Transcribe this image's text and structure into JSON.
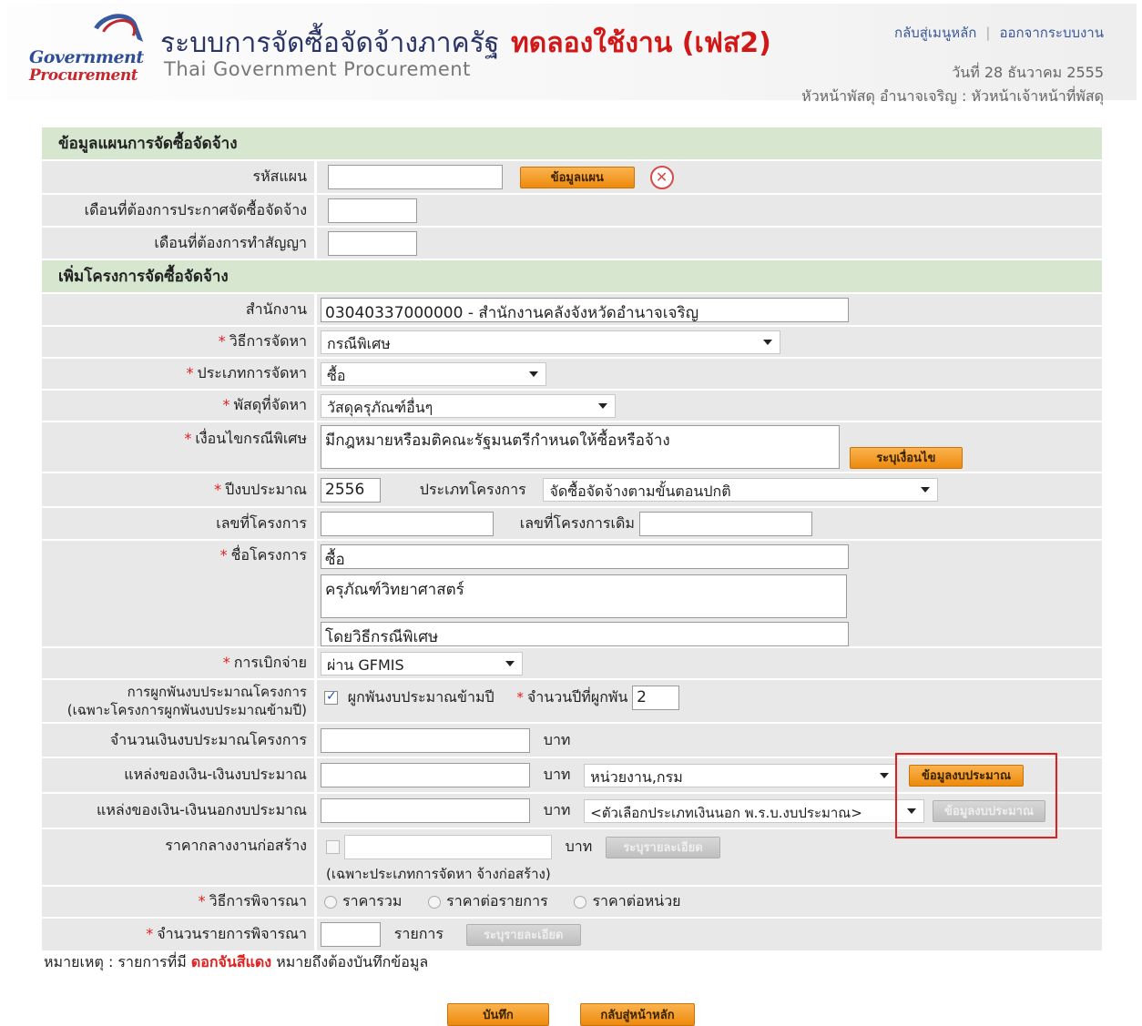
{
  "header": {
    "logo_line1": "Government",
    "logo_line2": "Procurement",
    "title_th": "ระบบการจัดซื้อจัดจ้างภาครัฐ",
    "title_trial": "ทดลองใช้งาน (เฟส2)",
    "title_en": "Thai Government Procurement",
    "link_home": "กลับสู่เมนูหลัก",
    "link_sep": "|",
    "link_logout": "ออกจากระบบงาน",
    "date": "วันที่ 28 ธันวาคม 2555",
    "user": "หัวหน้าพัสดุ อำนาจเจริญ : หัวหน้าเจ้าหน้าที่พัสดุ"
  },
  "plan_section": {
    "title": "ข้อมูลแผนการจัดซื้อจัดจ้าง",
    "plan_code_label": "รหัสแผน",
    "plan_code_value": "",
    "plan_info_button": "ข้อมูลแผน",
    "clear_icon": "x-circle-icon",
    "announce_month_label": "เดือนที่ต้องการประกาศจัดซื้อจัดจ้าง",
    "announce_month_value": "",
    "contract_month_label": "เดือนที่ต้องการทำสัญญา",
    "contract_month_value": ""
  },
  "project_section": {
    "title": "เพิ่มโครงการจัดซื้อจัดจ้าง",
    "required_mark": "*",
    "office_label": "สำนักงาน",
    "office_value": "03040337000000 - สำนักงานคลังจังหวัดอำนาจเจริญ",
    "method_label": "วิธีการจัดหา",
    "method_value": "กรณีพิเศษ",
    "type_label": "ประเภทการจัดหา",
    "type_value": "ซื้อ",
    "supplies_label": "พัสดุที่จัดหา",
    "supplies_value": "วัสดุครุภัณฑ์อื่นๆ",
    "condition_label": "เงื่อนไขกรณีพิเศษ",
    "condition_value": "มีกฎหมายหรือมติคณะรัฐมนตรีกำหนดให้ซื้อหรือจ้าง",
    "condition_button": "ระบุเงื่อนไข",
    "budget_year_label": "ปีงบประมาณ",
    "budget_year_value": "2556",
    "project_type_label": "ประเภทโครงการ",
    "project_type_value": "จัดซื้อจัดจ้างตามขั้นตอนปกติ",
    "project_no_label": "เลขที่โครงการ",
    "project_no_value": "",
    "old_project_no_label": "เลขที่โครงการเดิม",
    "old_project_no_value": "",
    "project_name_label": "ชื่อโครงการ",
    "project_name_1": "ซื้อ",
    "project_name_2": "ครุภัณฑ์วิทยาศาสตร์",
    "project_name_3": "โดยวิธีกรณีพิเศษ",
    "disbursement_label": "การเบิกจ่าย",
    "disbursement_value": "ผ่าน GFMIS",
    "binding_label_1": "การผูกพันงบประมาณโครงการ",
    "binding_label_2": "(เฉพาะโครงการผูกพันงบประมาณข้ามปี)",
    "binding_checkbox_label": "ผูกพันงบประมาณข้ามปี",
    "binding_checked": true,
    "binding_years_label": "จำนวนปีที่ผูกพัน",
    "binding_years_value": "2",
    "budget_amount_label": "จำนวนเงินงบประมาณโครงการ",
    "budget_amount_value": "",
    "unit_baht": "บาท",
    "source_budget_label": "แหล่งของเงิน-เงินงบประมาณ",
    "source_budget_value": "",
    "source_budget_select": "หน่วยงาน,กรม",
    "budget_info_button": "ข้อมูลงบประมาณ",
    "source_nonbudget_label": "แหล่งของเงิน-เงินนอกงบประมาณ",
    "source_nonbudget_value": "",
    "source_nonbudget_select": "<ตัวเลือกประเภทเงินนอก พ.ร.บ.งบประมาณ>",
    "nonbudget_info_button": "ข้อมูลงบประมาณ",
    "construction_label": "ราคากลางงานก่อสร้าง",
    "construction_value": "",
    "construction_button": "ระบุรายละเอียด",
    "construction_hint": "(เฉพาะประเภทการจัดหา จ้างก่อสร้าง)",
    "consider_label": "วิธีการพิจารณา",
    "consider_opt1": "ราคารวม",
    "consider_opt2": "ราคาต่อรายการ",
    "consider_opt3": "ราคาต่อหน่วย",
    "consider_count_label": "จำนวนรายการพิจารณา",
    "consider_count_value": "",
    "consider_count_unit": "รายการ",
    "consider_count_button": "ระบุรายละเอียด"
  },
  "note": {
    "prefix": "หมายเหตุ : รายการที่มี",
    "red": "ดอกจันสีแดง",
    "suffix": "หมายถึงต้องบันทึกข้อมูล"
  },
  "footer": {
    "save_button": "บันทึก",
    "back_button": "กลับสู่หน้าหลัก"
  },
  "colors": {
    "section_bg": "#d6e6cf",
    "row_bg": "#e8e8e8",
    "button_orange": "#f0960f",
    "required_red": "#e02020",
    "highlight_red": "#e0201f"
  }
}
